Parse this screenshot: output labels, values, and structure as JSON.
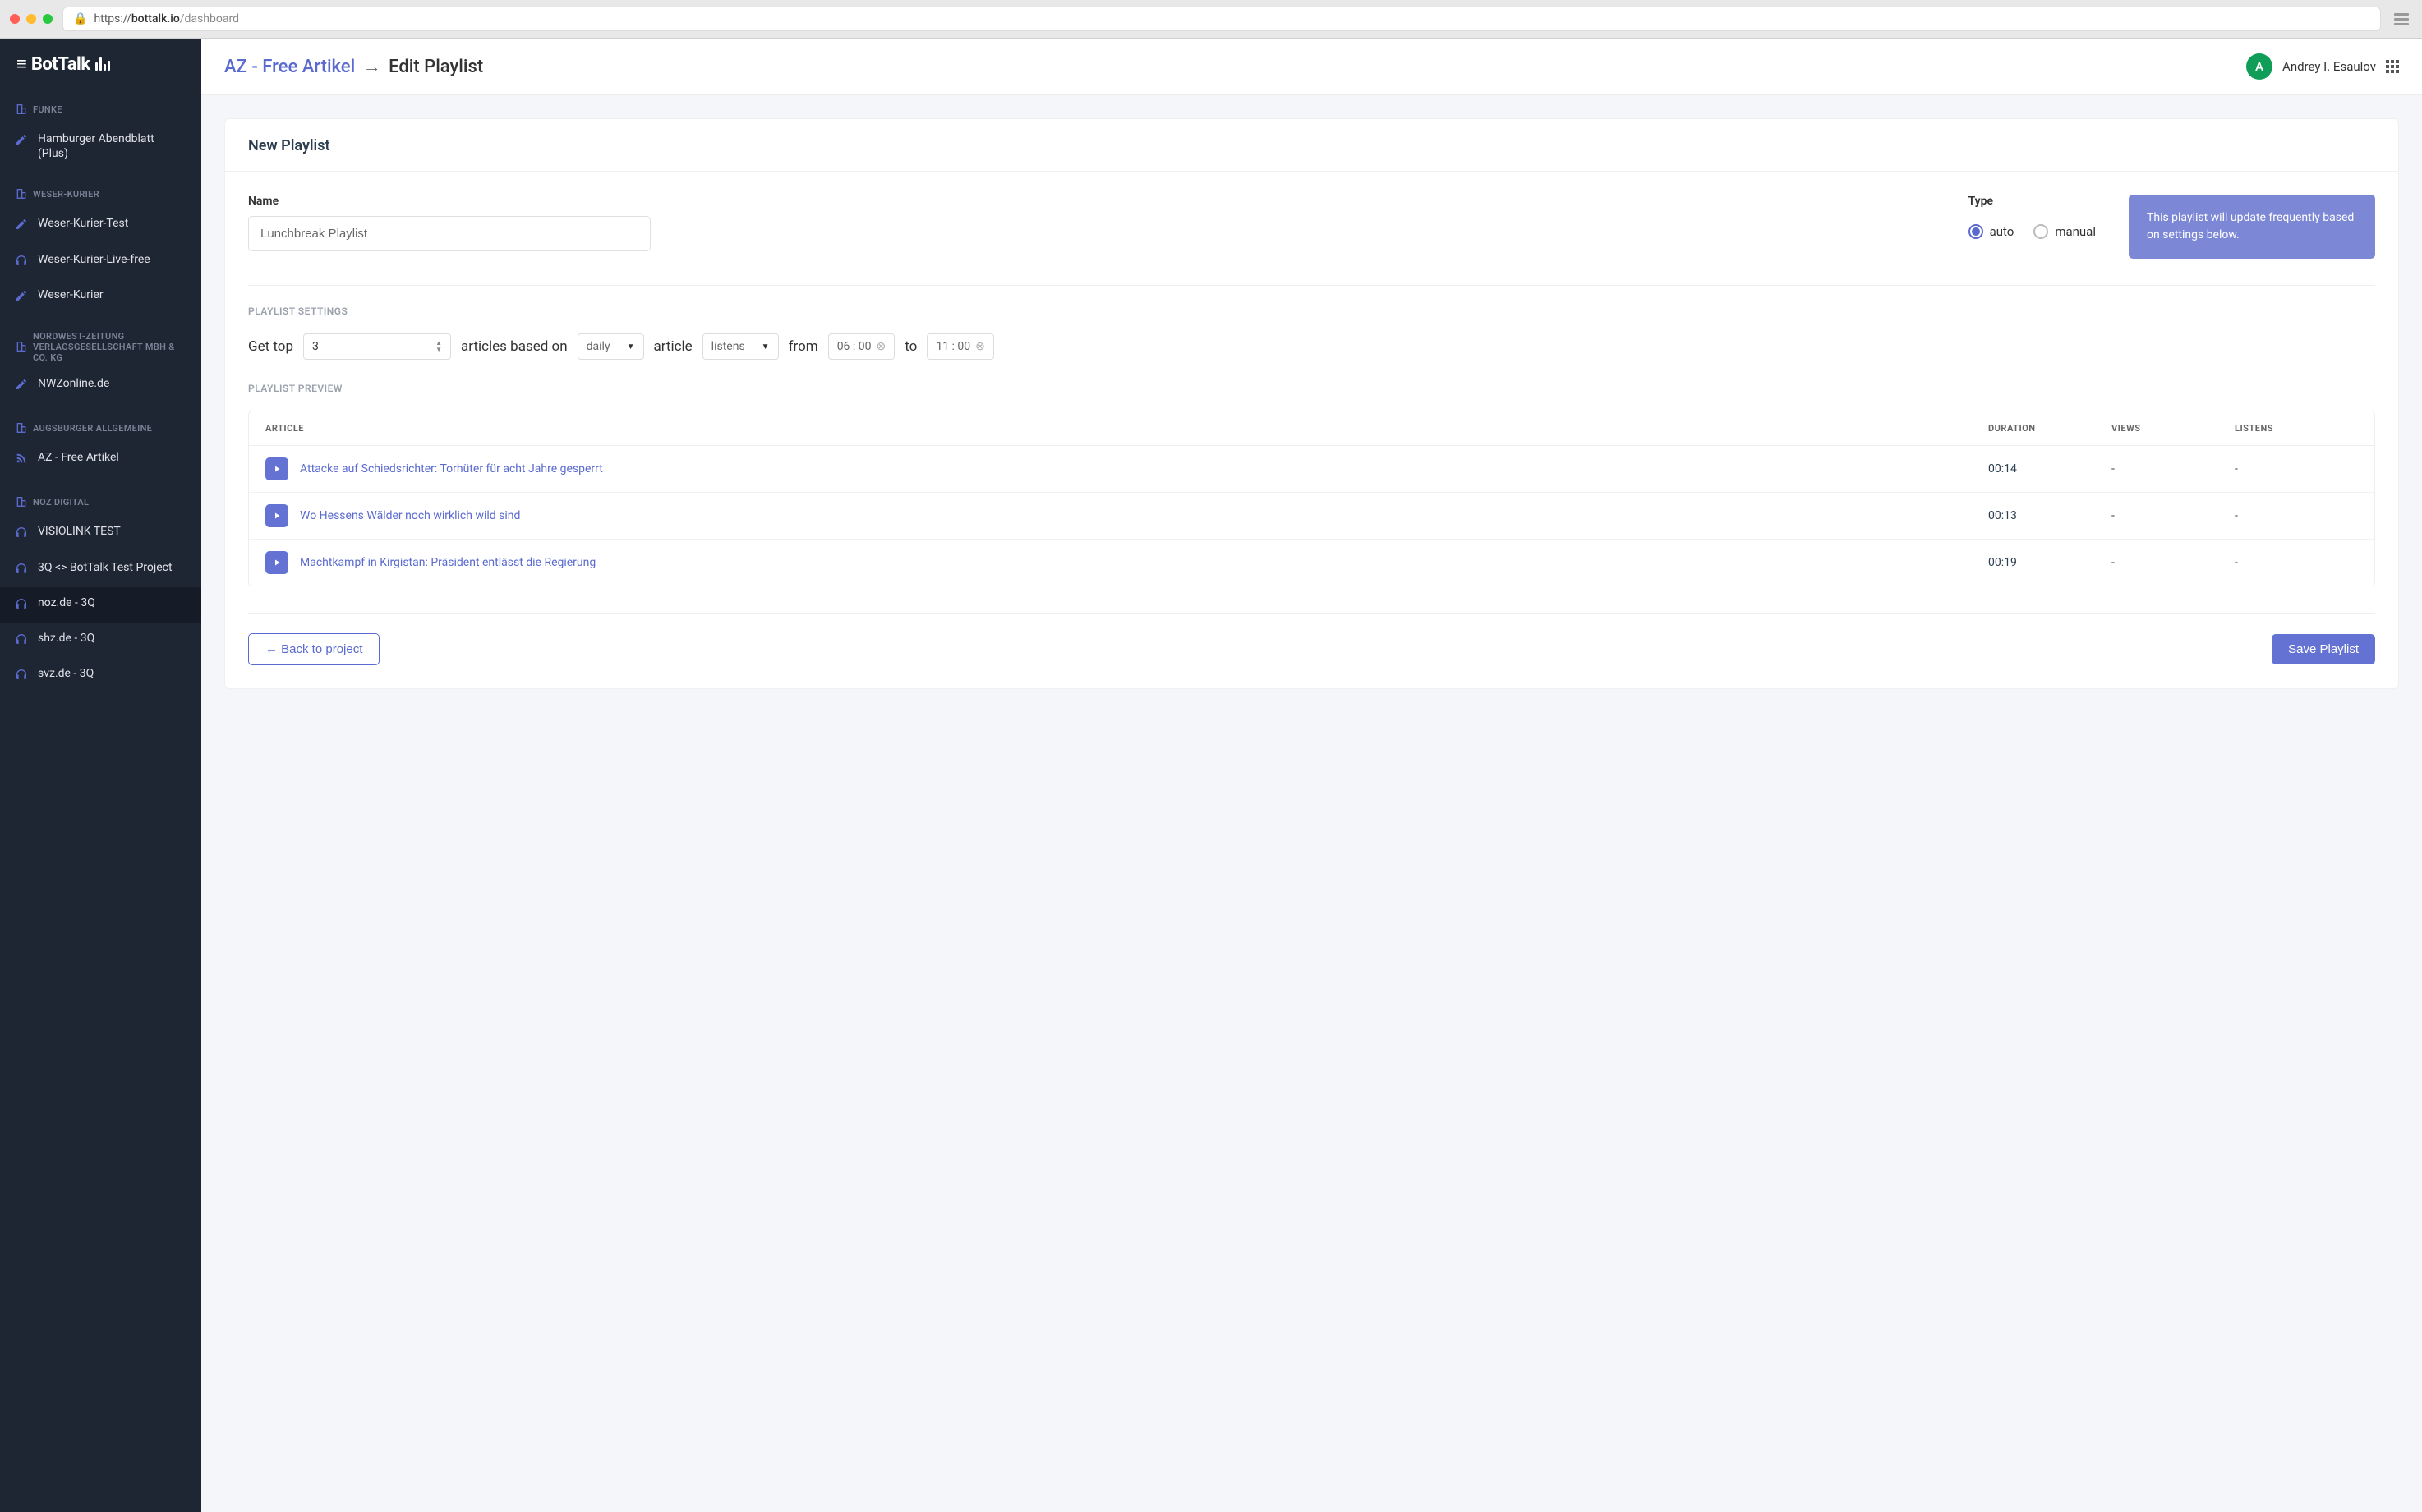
{
  "browser": {
    "url_prefix": "https://",
    "url_domain": "bottalk.io",
    "url_path": "/dashboard"
  },
  "logo": "BotTalk",
  "sidebar": {
    "sections": [
      {
        "header": "FUNKE",
        "items": [
          {
            "icon": "pencil",
            "label": "Hamburger Abendblatt (Plus)"
          }
        ]
      },
      {
        "header": "WESER-KURIER",
        "items": [
          {
            "icon": "pencil",
            "label": "Weser-Kurier-Test"
          },
          {
            "icon": "headphones",
            "label": "Weser-Kurier-Live-free"
          },
          {
            "icon": "pencil",
            "label": "Weser-Kurier"
          }
        ]
      },
      {
        "header": "NORDWEST-ZEITUNG VERLAGSGESELLSCHAFT MBH & CO. KG",
        "items": [
          {
            "icon": "pencil",
            "label": "NWZonline.de"
          }
        ]
      },
      {
        "header": "AUGSBURGER ALLGEMEINE",
        "items": [
          {
            "icon": "rss",
            "label": "AZ - Free Artikel"
          }
        ]
      },
      {
        "header": "NOZ DIGITAL",
        "items": [
          {
            "icon": "headphones",
            "label": "VISIOLINK TEST"
          },
          {
            "icon": "headphones",
            "label": "3Q <> BotTalk Test Project"
          },
          {
            "icon": "headphones",
            "label": "noz.de - 3Q",
            "active": true
          },
          {
            "icon": "headphones",
            "label": "shz.de - 3Q"
          },
          {
            "icon": "headphones",
            "label": "svz.de - 3Q"
          }
        ]
      }
    ]
  },
  "breadcrumb": {
    "project": "AZ - Free Artikel",
    "page": "Edit Playlist"
  },
  "user": {
    "initial": "A",
    "name": "Andrey I. Esaulov"
  },
  "card": {
    "title": "New Playlist",
    "name_label": "Name",
    "name_value": "Lunchbreak Playlist",
    "type_label": "Type",
    "type_auto": "auto",
    "type_manual": "manual",
    "info": "This playlist will update frequently based on settings below.",
    "settings_label": "PLAYLIST SETTINGS",
    "settings": {
      "get_top": "Get top",
      "top_value": "3",
      "articles_based_on": "articles based on",
      "period": "daily",
      "article_word": "article",
      "metric": "listens",
      "from": "from",
      "from_value": "06 : 00",
      "to": "to",
      "to_value": "11 : 00"
    },
    "preview_label": "PLAYLIST PREVIEW",
    "table": {
      "headers": {
        "article": "ARTICLE",
        "duration": "DURATION",
        "views": "VIEWS",
        "listens": "LISTENS"
      },
      "rows": [
        {
          "title": "Attacke auf Schiedsrichter: Torhüter für acht Jahre gesperrt",
          "duration": "00:14",
          "views": "-",
          "listens": "-"
        },
        {
          "title": "Wo Hessens Wälder noch wirklich wild sind",
          "duration": "00:13",
          "views": "-",
          "listens": "-"
        },
        {
          "title": "Machtkampf in Kirgistan: Präsident entlässt die Regierung",
          "duration": "00:19",
          "views": "-",
          "listens": "-"
        }
      ]
    },
    "back_button": "← Back to project",
    "save_button": "Save Playlist"
  }
}
